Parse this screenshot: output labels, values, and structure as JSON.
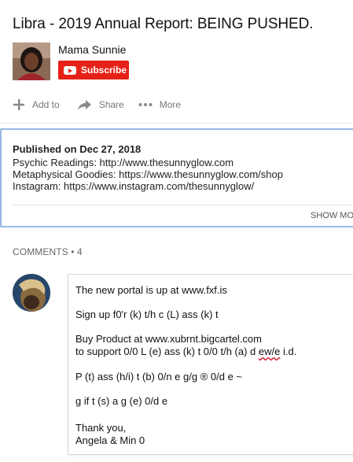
{
  "video": {
    "title": "Libra - 2019 Annual Report: BEING PUSHED."
  },
  "channel": {
    "name": "Mama Sunnie",
    "subscribe_label": "Subscribe"
  },
  "actions": [
    {
      "label": "Add to",
      "icon": "plus-icon"
    },
    {
      "label": "Share",
      "icon": "share-arrow-icon"
    },
    {
      "label": "More",
      "icon": "more-dots-icon"
    }
  ],
  "description": {
    "published": "Published on Dec 27, 2018",
    "lines": [
      "Psychic Readings: http://www.thesunnyglow.com",
      "Metaphysical Goodies: https://www.thesunnyglow.com/shop",
      "Instagram: https://www.instagram.com/thesunnyglow/"
    ],
    "show_more_label": "SHOW MORE"
  },
  "comments": {
    "label": "COMMENTS",
    "separator": " • ",
    "count": "4",
    "items": [
      {
        "lines": [
          "The new portal is up at www.fxf.is",
          "Sign up f0'r (k) t/h c (L) ass (k) t",
          "Buy Product at www.xubrnt.bigcartel.com",
          "to support 0/0 L (e) ass (k) t 0/0 t/h (a) d ",
          "ew/e",
          " i.d.",
          "P (t) ass (h/i) t (b) 0/n e g/g ® 0/d e ~",
          "g if t (s) a g (e) 0/d e",
          "Thank you,",
          "Angela & Min 0"
        ]
      }
    ]
  },
  "colors": {
    "subscribe_red": "#e62117",
    "focus_border": "#98b8e6"
  }
}
